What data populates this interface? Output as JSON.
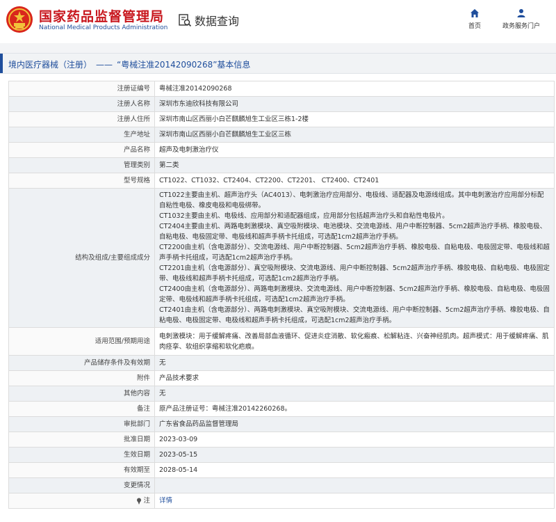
{
  "header": {
    "title_cn": "国家药品监督管理局",
    "title_en": "National Medical Products Administration",
    "query_label": "数据查询",
    "nav": [
      {
        "label": "首页",
        "icon": "home-icon"
      },
      {
        "label": "政务服务门户",
        "icon": "user-icon"
      }
    ]
  },
  "breadcrumb": {
    "section": "境内医疗器械（注册）",
    "separator": "——",
    "record": "“粤械注准20142090268”基本信息"
  },
  "colors": {
    "brand_red": "#c8161d",
    "brand_blue": "#1f4e9c",
    "row_alt": "#eef1f4"
  },
  "rows": [
    {
      "label": "注册证编号",
      "value": [
        "粤械注准20142090268"
      ]
    },
    {
      "label": "注册人名称",
      "value": [
        "深圳市东迪欣科技有限公司"
      ]
    },
    {
      "label": "注册人住所",
      "value": [
        "深圳市南山区西丽小白芒麒麟旭生工业区三栋1-2楼"
      ]
    },
    {
      "label": "生产地址",
      "value": [
        "深圳市南山区西丽小白芒麒麟旭生工业区三栋"
      ]
    },
    {
      "label": "产品名称",
      "value": [
        "超声及电刺激治疗仪"
      ]
    },
    {
      "label": "管理类别",
      "value": [
        "第二类"
      ]
    },
    {
      "label": "型号规格",
      "value": [
        "CT1022、CT1032、CT2404、CT2200、CT2201、 CT2400、CT2401"
      ]
    },
    {
      "label": "结构及组成/主要组成成分",
      "value": [
        "CT1022主要由主机、超声治疗头（AC4013）、电刺激治疗应用部分、电极线、适配器及电源线组成。其中电刺激治疗应用部分标配自粘性电极、橡皮电极和电极绑带。",
        "CT1032主要由主机、电极线、应用部分和适配器组成，应用部分包括超声治疗头和自粘性电极片。",
        "CT2404主要由主机、两路电刺激模块、真空吸附模块、电池模块、交流电源线、用户中断控制器、5cm2超声治疗手柄、橡胶电极、自粘电极、电极固定带、电极线和超声手柄卡托组成，可选配1cm2超声治疗手柄。",
        "CT2200由主机（含电源部分）、交流电源线、用户中断控制器、5cm2超声治疗手柄、橡胶电极、自粘电极、电极固定带、电极线和超声手柄卡托组成，可选配1cm2超声治疗手柄。",
        "CT2201由主机（含电源部分）、真空吸附模块、交流电源线、用户中断控制器、5cm2超声治疗手柄、橡胶电极、自粘电极、电极固定带、电极线和超声手柄卡托组成，可选配1cm2超声治疗手柄。",
        "CT2400由主机（含电源部分）、两路电刺激模块、交流电源线、用户中断控制器、5cm2超声治疗手柄、橡胶电极、自粘电极、电极固定带、电极线和超声手柄卡托组成，可选配1cm2超声治疗手柄。",
        "CT2401由主机（含电源部分）、两路电刺激模块、真空吸附模块、交流电源线、用户中断控制器、5cm2超声治疗手柄、橡胶电极、自粘电极、电极固定带、电极线和超声手柄卡托组成，可选配1cm2超声治疗手柄。"
      ]
    },
    {
      "label": "适用范围/预期用途",
      "value": [
        "电刺激模块：用于缓解疼痛、改善局部血液循环、促进炎症消散、软化瘢痕、松解粘连、兴奋神经肌肉。超声模式：用于缓解疼痛、肌肉痉挛、软组织挛缩和软化疤痕。"
      ]
    },
    {
      "label": "产品储存条件及有效期",
      "value": [
        "无"
      ]
    },
    {
      "label": "附件",
      "value": [
        "产品技术要求"
      ]
    },
    {
      "label": "其他内容",
      "value": [
        "无"
      ]
    },
    {
      "label": "备注",
      "value": [
        "原产品注册证号：粤械注准20142260268。"
      ]
    },
    {
      "label": "审批部门",
      "value": [
        "广东省食品药品监督管理局"
      ]
    },
    {
      "label": "批准日期",
      "value": [
        "2023-03-09"
      ]
    },
    {
      "label": "生效日期",
      "value": [
        "2023-05-15"
      ]
    },
    {
      "label": "有效期至",
      "value": [
        "2028-05-14"
      ]
    },
    {
      "label": "变更情况",
      "value": [
        ""
      ]
    },
    {
      "label": "注",
      "value": [
        "详情"
      ],
      "link": true,
      "icon": "pin-icon"
    }
  ]
}
